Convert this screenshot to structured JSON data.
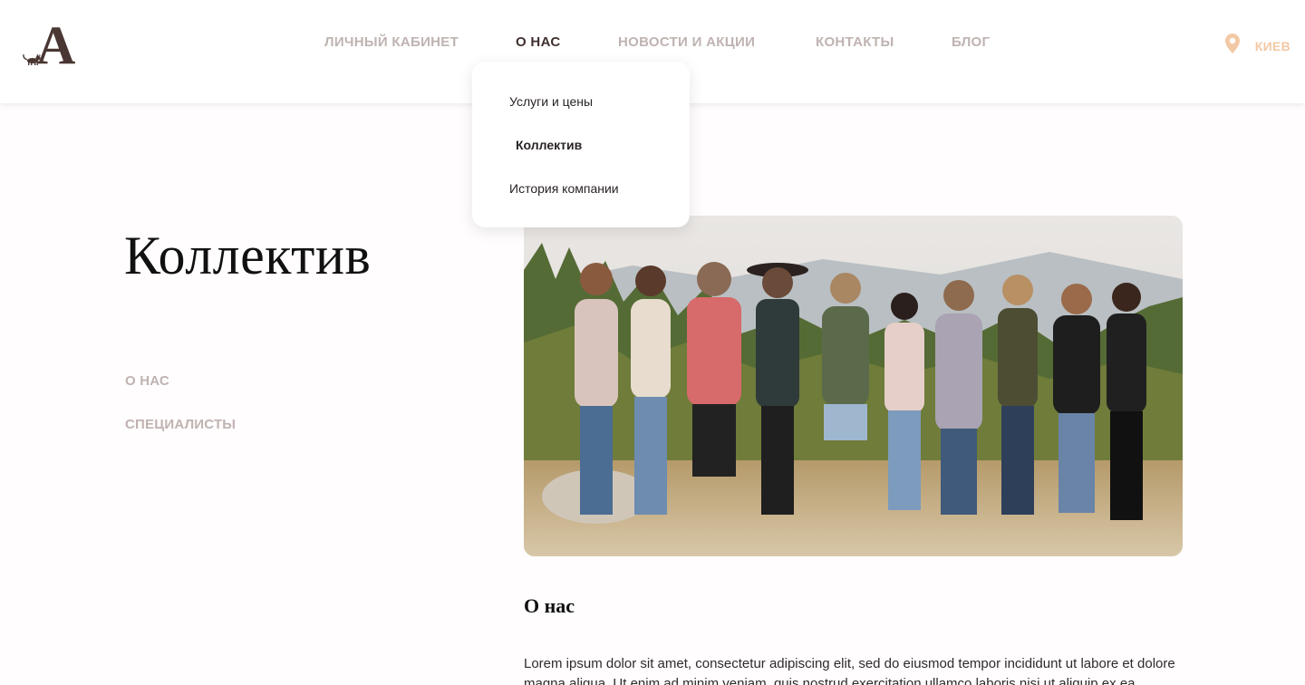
{
  "header": {
    "logo_letter": "A",
    "nav": [
      {
        "label": "ЛИЧНЫЙ КАБИНЕТ",
        "active": false
      },
      {
        "label": "О НАС",
        "active": true
      },
      {
        "label": "НОВОСТИ И АКЦИИ",
        "active": false
      },
      {
        "label": "КОНТАКТЫ",
        "active": false
      },
      {
        "label": "БЛОГ",
        "active": false
      }
    ],
    "city": {
      "icon": "location-pin-icon",
      "label": "КИЕВ"
    }
  },
  "dropdown": {
    "items": [
      {
        "label": "Услуги и цены",
        "active": false
      },
      {
        "label": "Коллектив",
        "active": true
      },
      {
        "label": "История компании",
        "active": false
      }
    ]
  },
  "page": {
    "title": "Коллектив",
    "side_links": [
      "О НАС",
      "СПЕЦИАЛИСТЫ"
    ]
  },
  "content": {
    "section_title": "О нас",
    "paragraph": "Lorem ipsum dolor sit amet, consectetur adipiscing elit, sed do eiusmod tempor incididunt ut labore et dolore magna aliqua. Ut enim ad minim veniam, quis nostrud exercitation ullamco laboris nisi ut aliquip ex ea commodo"
  },
  "colors": {
    "brand_brown": "#4a3733",
    "nav_inactive": "#bfb3b1",
    "accent_peach": "#f3c9a5"
  }
}
